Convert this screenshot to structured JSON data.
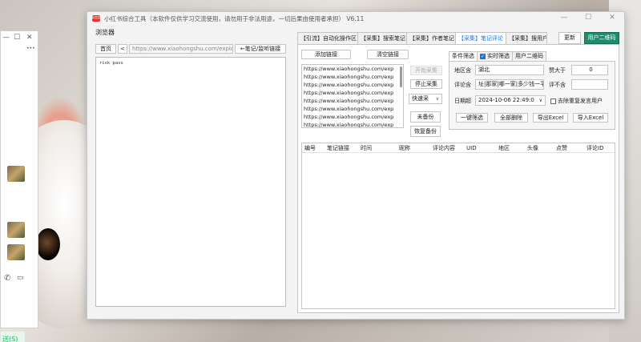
{
  "bg_window": {
    "controls": [
      "—",
      "☐",
      "✕"
    ],
    "more": "•••",
    "green_text": "送(S)"
  },
  "app": {
    "icon_text": "RED",
    "title": "小红书综合工具（本软件仅供学习交流使用，请勿用于非法用途，一切后果由使用者承担） V6.11",
    "accent": "#1a73e8",
    "brand": "#1e8b6e"
  },
  "browser": {
    "label": "浏览器",
    "home": "首页",
    "back": "<",
    "url": "https://www.xiaohongshu.com/explore",
    "monitor": "←笔记/监听链接",
    "content": "risk pass"
  },
  "tabs": [
    "【引流】自动化操作区",
    "【采集】搜索笔记",
    "【采集】作者笔记",
    "【采集】笔记评论",
    "【采集】搜用户"
  ],
  "active_tab": 3,
  "refresh": "更新",
  "qrcode": "用户二维码",
  "panel": {
    "add_link": "添加链接",
    "clear_link": "清空链接",
    "links": [
      "https://www.xiaohongshu.com/exp",
      "https://www.xiaohongshu.com/exp",
      "https://www.xiaohongshu.com/exp",
      "https://www.xiaohongshu.com/exp",
      "https://www.xiaohongshu.com/exp",
      "https://www.xiaohongshu.com/exp",
      "https://www.xiaohongshu.com/exp",
      "https://www.xiaohongshu.com/exp"
    ],
    "start": "开始采集",
    "stop": "停止采集",
    "speed": "快速采",
    "unbackup": "未备份",
    "restore": "恢复备份"
  },
  "filter": {
    "tab_condition": "条件筛选",
    "tab_realtime": "实时筛选",
    "tab_qrcode": "用户二维码",
    "region_label": "地区含",
    "region_value": "湖北",
    "likes_label": "赞大于",
    "likes_value": "0",
    "comment_label": "评论含",
    "comment_value": "址|那家|哪一家|多少钱一平",
    "exclude_label": "评不含",
    "exclude_value": "",
    "date_label": "日期超",
    "date_value": "2024-10-06 22:49:0",
    "dedup_label": "去除重复发言用户",
    "one_click": "一键筛选",
    "delete_all": "全部删除",
    "export": "导出Excel",
    "import": "导入Excel"
  },
  "table": {
    "columns": [
      "编号",
      "笔记链接",
      "时间",
      "昵称",
      "评论内容",
      "UID",
      "地区",
      "头像",
      "点赞",
      "评论ID"
    ]
  }
}
